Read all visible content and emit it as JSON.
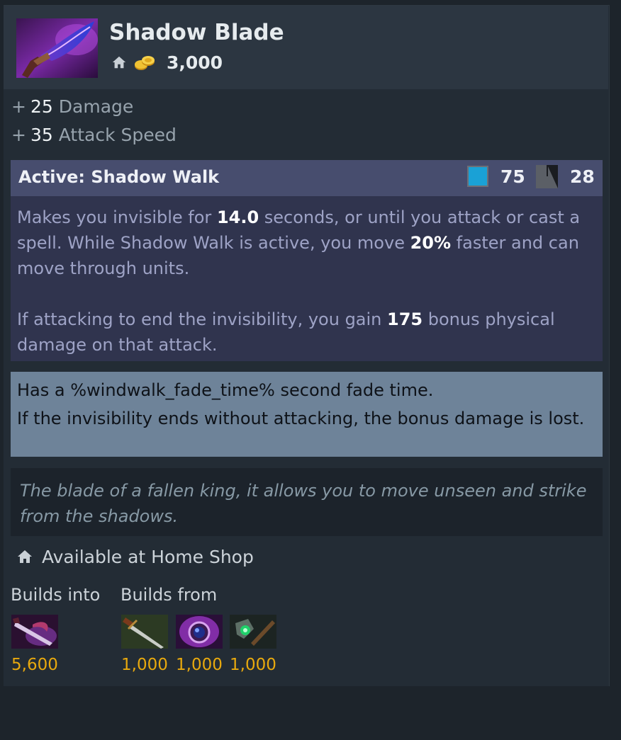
{
  "item": {
    "name": "Shadow Blade",
    "cost": "3,000",
    "icon": "shadow-blade-icon"
  },
  "stats": [
    {
      "sign": "+",
      "value": "25",
      "label": "Damage"
    },
    {
      "sign": "+",
      "value": "35",
      "label": "Attack Speed"
    }
  ],
  "active": {
    "name": "Active: Shadow Walk",
    "mana_cost": "75",
    "cooldown": "28",
    "desc1_a": "Makes you invisible for ",
    "desc1_b": "14.0",
    "desc1_c": " seconds, or until you attack or cast a spell. While Shadow Walk is active, you move ",
    "desc1_d": "20%",
    "desc1_e": " faster and can move through units.",
    "desc2_a": "If attacking to end the invisibility, you gain ",
    "desc2_b": "175",
    "desc2_c": " bonus physical damage on that attack."
  },
  "notes": [
    "Has a %windwalk_fade_time% second fade time.",
    "If the invisibility ends without attacking, the bonus damage is lost."
  ],
  "lore": "The blade of a fallen king, it allows you to move unseen and strike from the shadows.",
  "availability": "Available at Home Shop",
  "builds_into": {
    "label": "Builds into",
    "items": [
      {
        "icon": "silver-edge-icon",
        "cost": "5,600"
      }
    ]
  },
  "builds_from": {
    "label": "Builds from",
    "items": [
      {
        "icon": "claymore-icon",
        "cost": "1,000"
      },
      {
        "icon": "shadow-amulet-icon",
        "cost": "1,000"
      },
      {
        "icon": "quarterstaff-icon",
        "cost": "1,000"
      }
    ]
  },
  "colors": {
    "card_bg": "#232c35",
    "header_bg": "#2c3641",
    "active_header_bg": "#474d6e",
    "active_body_bg": "#30344e",
    "note_bg": "#6e8399",
    "lore_bg": "#1c232b",
    "gold": "#e8a90e",
    "mana": "#1aa1d6"
  }
}
